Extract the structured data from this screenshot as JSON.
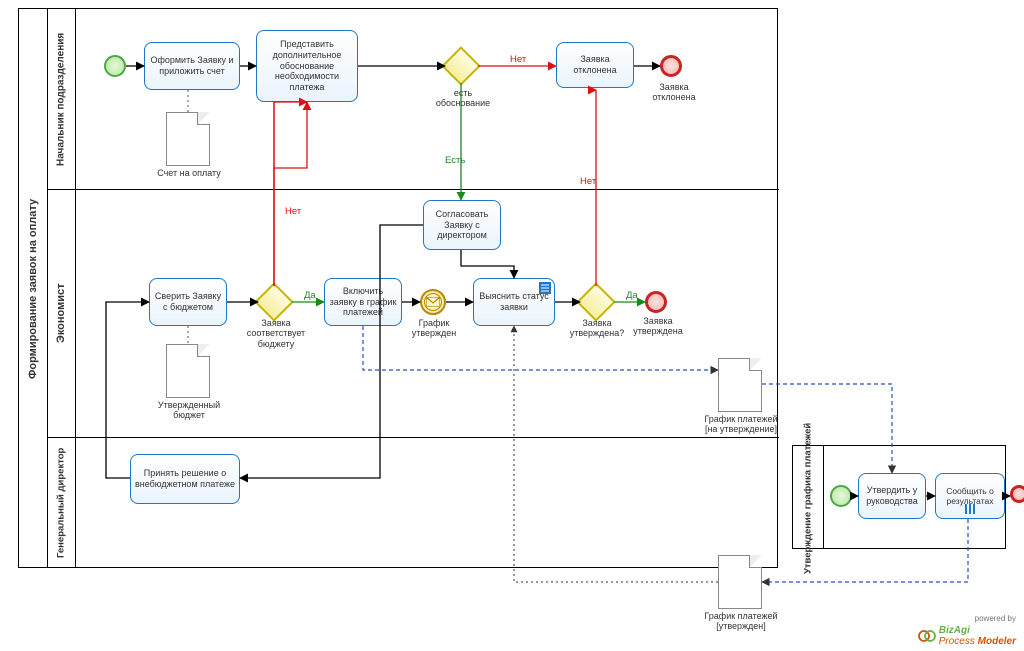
{
  "pool1": {
    "title": "Формирование заявок на оплату",
    "lanes": {
      "lane1": "Начальник подразделения",
      "lane2": "Экономист",
      "lane3": "Генеральный директор"
    }
  },
  "pool2": {
    "title": "Утверждение графика платежей"
  },
  "activities": {
    "a1": "Оформить  Заявку и приложить счет",
    "a2": "Представить дополнительное обоснование необходимости платежа",
    "a3": "Заявка отклонена",
    "a4": "Согласовать Заявку с директором",
    "a5": "Сверить Заявку с бюджетом",
    "a6": "Включить заявку в график платежей",
    "a7": "Выяснить статус заявки",
    "a8": "Принять решение о внебюджетном платеже",
    "a9": "Утвердить у руководства",
    "a10": "Сообщить о результатах"
  },
  "gateways": {
    "g1": "есть обоснование",
    "g2": "Заявка соответствует бюджету",
    "g3": "Заявка утверждена?"
  },
  "events": {
    "e_end1": "Заявка отклонена",
    "e_msg": "График утвержден",
    "e_end2": "Заявка утверждена"
  },
  "docs": {
    "d1": "Счет на оплату",
    "d2": "Утвержденный бюджет",
    "d3": "График платежей [на утверждение]",
    "d4": "График платежей [утвержден]"
  },
  "flows": {
    "no": "Нет",
    "yes_g2": "Да",
    "yes_g3": "Да",
    "est": "Есть"
  },
  "branding": {
    "powered": "powered by",
    "name1": "BizAgi",
    "name2": "Process ",
    "name3": "Modeler"
  }
}
